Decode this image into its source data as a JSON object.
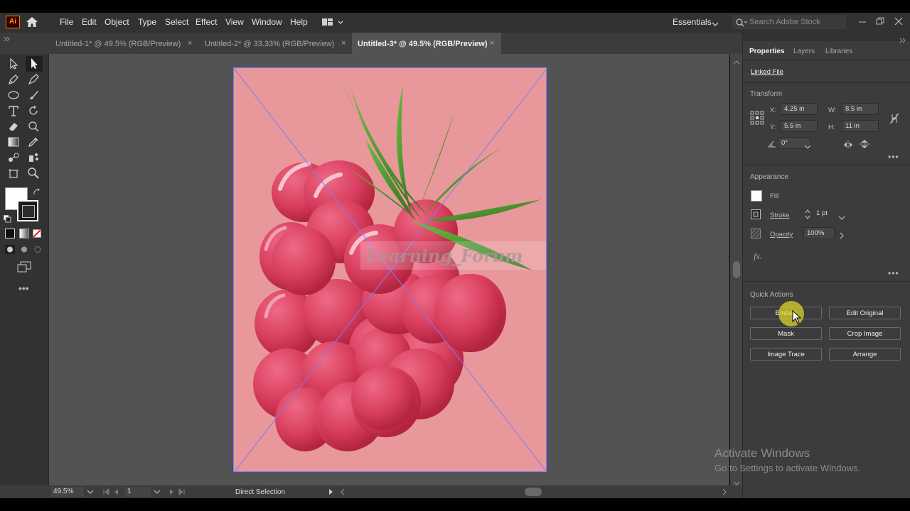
{
  "app": {
    "logo": "Ai"
  },
  "menu": [
    "File",
    "Edit",
    "Object",
    "Type",
    "Select",
    "Effect",
    "View",
    "Window",
    "Help"
  ],
  "workspace": {
    "label": "Essentials"
  },
  "search": {
    "placeholder": "Search Adobe Stock"
  },
  "tabs": [
    {
      "label": "Untitled-1* @ 49.5% (RGB/Preview)",
      "active": false
    },
    {
      "label": "Untitled-2* @ 33.33% (RGB/Preview)",
      "active": false
    },
    {
      "label": "Untitled-3* @ 49.5% (RGB/Preview)",
      "active": true
    }
  ],
  "tab_close": "×",
  "canvas": {
    "watermark": "Learning_Forum",
    "artboard_color": "#e8979a",
    "berry_color": "#d93f5e",
    "leaf_color": "#3e8a2a"
  },
  "status": {
    "zoom": "49.5%",
    "artboard": "1",
    "tool": "Direct Selection"
  },
  "panel": {
    "tabs": [
      "Properties",
      "Layers",
      "Libraries"
    ],
    "linked_file": "Linked File",
    "transform": {
      "title": "Transform",
      "x_label": "X:",
      "x_value": "4.25 in",
      "y_label": "Y:",
      "y_value": "5.5 in",
      "w_label": "W:",
      "w_value": "8.5 in",
      "h_label": "H:",
      "h_value": "11 in",
      "angle_value": "0°"
    },
    "appearance": {
      "title": "Appearance",
      "fill": "Fill",
      "stroke": "Stroke",
      "stroke_value": "1 pt",
      "opacity": "Opacity",
      "opacity_value": "100%",
      "fx": "fx."
    },
    "quick_actions": {
      "title": "Quick Actions",
      "buttons": [
        "Embed",
        "Edit Original",
        "Mask",
        "Crop Image",
        "Image Trace",
        "Arrange"
      ]
    }
  },
  "windows_notice": {
    "line1": "Activate Windows",
    "line2": "Go to Settings to activate Windows."
  }
}
